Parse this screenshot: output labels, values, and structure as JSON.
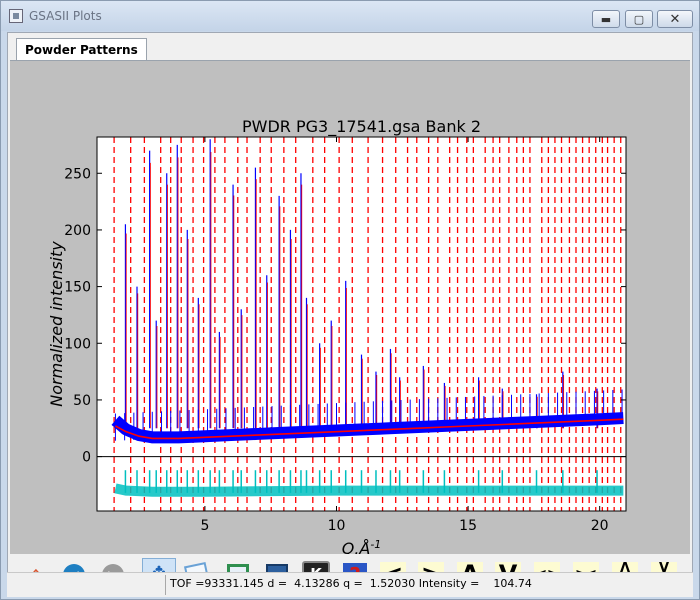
{
  "window": {
    "title": "GSASII Plots",
    "min_glyph": "▬",
    "max_glyph": "▢",
    "close_glyph": "✕"
  },
  "tabs": [
    {
      "label": "Powder Patterns",
      "active": true
    }
  ],
  "chart_data": {
    "type": "scatter",
    "title": "PWDR PG3_17541.gsa Bank 2",
    "xlabel": "Q,Å^-1",
    "ylabel": "Normalized intensity",
    "xlim": [
      0.9,
      21.0
    ],
    "ylim": [
      -48,
      282
    ],
    "xticks": [
      5,
      10,
      15,
      20
    ],
    "yticks": [
      0,
      50,
      100,
      150,
      200,
      250
    ],
    "colors": {
      "observed": "#0000ff",
      "calculated": "#ff0000",
      "reflections": "#ff0000",
      "difference": "#00bfbf",
      "zero_line": "#000000"
    },
    "series": [
      {
        "role": "observed",
        "x": [
          1.6,
          2,
          2.5,
          3,
          4,
          5,
          6,
          7,
          8,
          9,
          10,
          11,
          12,
          13,
          14,
          15,
          16,
          17,
          18,
          19,
          20,
          20.9
        ],
        "y": [
          32,
          24,
          19,
          17,
          17,
          18,
          19,
          20,
          21,
          22,
          23,
          24,
          25,
          26,
          27,
          28,
          29,
          30,
          31,
          32,
          33,
          34
        ]
      },
      {
        "role": "calculated",
        "x": [
          1.6,
          2,
          2.5,
          3,
          4,
          5,
          6,
          7,
          8,
          9,
          10,
          11,
          12,
          13,
          14,
          15,
          16,
          17,
          18,
          19,
          20,
          20.9
        ],
        "y": [
          27,
          22,
          18,
          16,
          16,
          17,
          18,
          19,
          20,
          21,
          22,
          23,
          24,
          25,
          26,
          27,
          28,
          29,
          30,
          31,
          32,
          33
        ]
      },
      {
        "role": "difference",
        "x": [
          1.6,
          2,
          3,
          5,
          10,
          15,
          20,
          20.9
        ],
        "y": [
          -28,
          -30,
          -31,
          -31,
          -30,
          -30,
          -30,
          -30
        ]
      }
    ],
    "peaks": [
      {
        "x": 1.98,
        "y": 205
      },
      {
        "x": 2.42,
        "y": 150
      },
      {
        "x": 2.9,
        "y": 270
      },
      {
        "x": 3.15,
        "y": 120
      },
      {
        "x": 3.55,
        "y": 250
      },
      {
        "x": 3.95,
        "y": 275
      },
      {
        "x": 4.33,
        "y": 200
      },
      {
        "x": 4.75,
        "y": 140
      },
      {
        "x": 5.2,
        "y": 280
      },
      {
        "x": 5.55,
        "y": 110
      },
      {
        "x": 6.07,
        "y": 240
      },
      {
        "x": 6.38,
        "y": 130
      },
      {
        "x": 6.92,
        "y": 255
      },
      {
        "x": 7.35,
        "y": 160
      },
      {
        "x": 7.82,
        "y": 230
      },
      {
        "x": 8.25,
        "y": 200
      },
      {
        "x": 8.65,
        "y": 250
      },
      {
        "x": 8.86,
        "y": 140
      },
      {
        "x": 9.36,
        "y": 100
      },
      {
        "x": 9.8,
        "y": 120
      },
      {
        "x": 10.35,
        "y": 155
      },
      {
        "x": 10.95,
        "y": 90
      },
      {
        "x": 11.5,
        "y": 75
      },
      {
        "x": 12.05,
        "y": 95
      },
      {
        "x": 12.4,
        "y": 70
      },
      {
        "x": 13.3,
        "y": 80
      },
      {
        "x": 14.1,
        "y": 65
      },
      {
        "x": 15.4,
        "y": 70
      },
      {
        "x": 16.3,
        "y": 60
      },
      {
        "x": 17.6,
        "y": 55
      },
      {
        "x": 18.6,
        "y": 75
      },
      {
        "x": 19.9,
        "y": 60
      }
    ],
    "reflections_x": [
      1.55,
      2.18,
      2.7,
      3.32,
      3.7,
      4.1,
      4.55,
      4.95,
      5.38,
      5.76,
      6.25,
      6.6,
      7.1,
      7.52,
      8.0,
      8.45,
      9.1,
      9.55,
      10.1,
      10.6,
      11.2,
      11.75,
      12.25,
      12.7,
      13.05,
      13.5,
      13.85,
      14.3,
      14.6,
      14.95,
      15.2,
      15.65,
      15.95,
      16.2,
      16.55,
      16.85,
      17.1,
      17.35,
      17.8,
      18.05,
      18.3,
      18.55,
      18.85,
      19.1,
      19.35,
      19.6,
      19.85,
      20.1,
      20.3,
      20.55,
      20.8
    ]
  },
  "toolbar": {
    "items": [
      {
        "name": "home-button",
        "icon": "home-icon",
        "color": "#d8552f"
      },
      {
        "name": "back-button",
        "icon": "arrow-left-icon",
        "color": "#1e7fc2"
      },
      {
        "name": "forward-button",
        "icon": "arrow-right-icon",
        "color": "#9a9a9a"
      },
      {
        "name": "pan-button",
        "icon": "move-icon",
        "color": "#1c64b8",
        "active": true
      },
      {
        "name": "zoom-button",
        "icon": "zoom-rect-icon",
        "color": "#6aa2d6"
      },
      {
        "name": "subplots-button",
        "icon": "configure-subplots-icon",
        "color": "#2f8f4f"
      },
      {
        "name": "save-button",
        "icon": "floppy-disk-icon",
        "color": "#2c5f9e"
      },
      {
        "name": "key-button",
        "text": "K",
        "icon": "key-icon",
        "color": "#222222"
      },
      {
        "name": "help-button",
        "text": "?",
        "icon": "help-icon",
        "color": "#d11b1b"
      },
      {
        "name": "shift-left-button",
        "text": "<",
        "icon": "less-than-icon",
        "yellow": true
      },
      {
        "name": "shift-right-button",
        "text": ">",
        "icon": "greater-than-icon",
        "yellow": true
      },
      {
        "name": "shift-up-button",
        "text": "Λ",
        "icon": "caret-up-icon",
        "yellow": true
      },
      {
        "name": "shift-down-button",
        "text": "V",
        "icon": "caret-down-icon",
        "yellow": true
      },
      {
        "name": "expand-x-button",
        "text": "<>",
        "icon": "expand-x-icon",
        "yellow": true
      },
      {
        "name": "shrink-x-button",
        "text": "><",
        "icon": "shrink-x-icon",
        "yellow": true
      },
      {
        "name": "expand-y-button",
        "text": "Λ\nV",
        "icon": "expand-y-icon",
        "yellow": true
      },
      {
        "name": "shrink-y-button",
        "text": "V\nΛ",
        "icon": "shrink-y-icon",
        "yellow": true
      }
    ]
  },
  "status": {
    "text": "TOF =93331.145 d =  4.13286 q =  1.52030 Intensity =    104.74"
  }
}
